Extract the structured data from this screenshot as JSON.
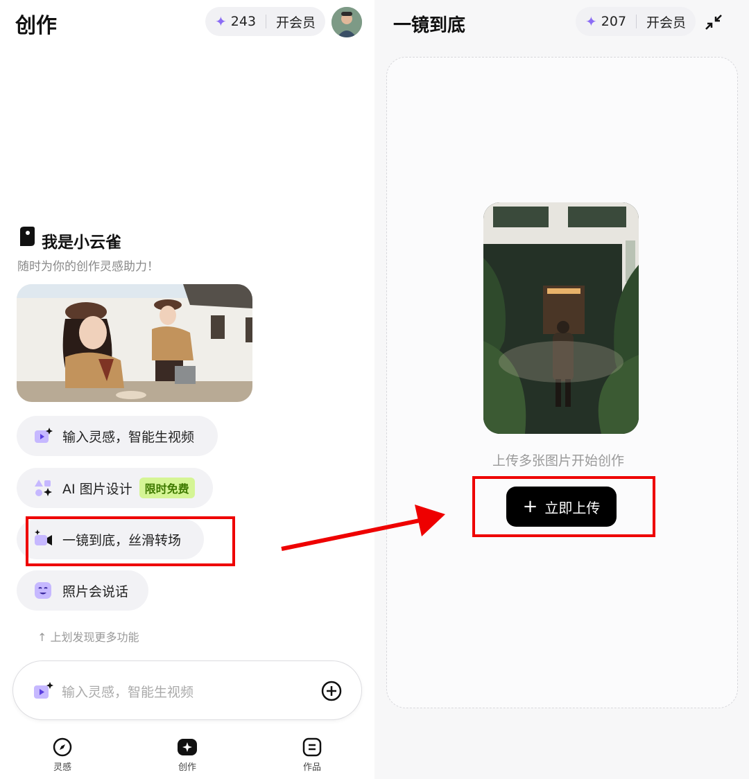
{
  "left": {
    "title": "创作",
    "credits": "243",
    "vip_label": "开会员",
    "greeting_title": "我是小云雀",
    "greeting_subtitle": "随时为你的创作灵感助力！",
    "chips": [
      {
        "label": "输入灵感，智能生视频",
        "icon": "video-spark-icon"
      },
      {
        "label": "AI 图片设计",
        "badge": "限时免费",
        "icon": "shapes-icon"
      },
      {
        "label": "一镜到底，丝滑转场",
        "icon": "camera-spark-icon"
      },
      {
        "label": "照片会说话",
        "icon": "smile-face-icon"
      }
    ],
    "hint": "↑ 上划发现更多功能",
    "input_placeholder": "输入灵感，智能生视频",
    "tabs": [
      {
        "label": "灵感",
        "icon": "compass-icon"
      },
      {
        "label": "创作",
        "icon": "sparkle-icon"
      },
      {
        "label": "作品",
        "icon": "list-icon"
      }
    ]
  },
  "right": {
    "title": "一镜到底",
    "credits": "207",
    "vip_label": "开会员",
    "upload_hint": "上传多张图片开始创作",
    "upload_button": "立即上传"
  },
  "colors": {
    "accent_purple": "#8b6cf5",
    "highlight_red": "#ee0000",
    "badge_green": "#d5f595"
  }
}
